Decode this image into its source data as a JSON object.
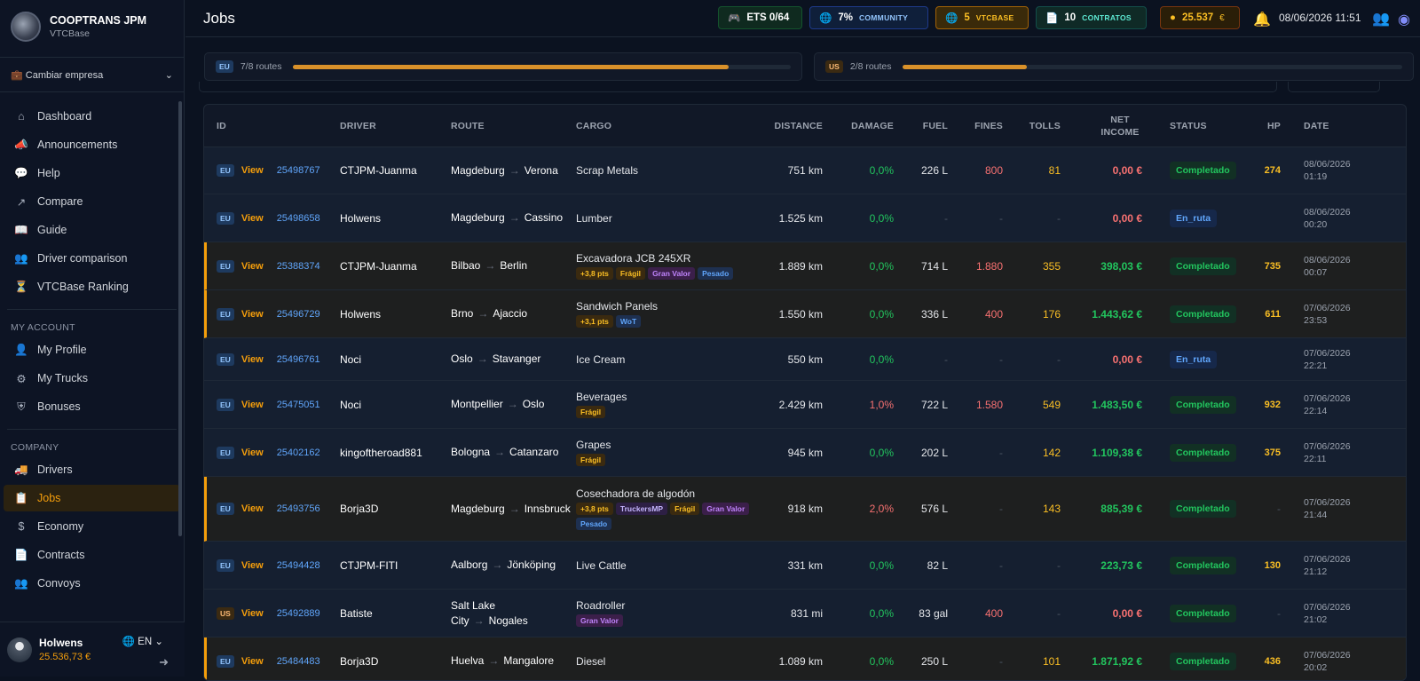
{
  "sidebar": {
    "brand_title": "COOPTRANS JPM",
    "brand_sub": "VTCBase",
    "company_switch": "Cambiar empresa",
    "main_items": [
      {
        "label": "Dashboard",
        "icon": "home-icon"
      },
      {
        "label": "Announcements",
        "icon": "megaphone-icon"
      },
      {
        "label": "Help",
        "icon": "chat-icon"
      },
      {
        "label": "Compare",
        "icon": "chart-line-icon"
      },
      {
        "label": "Guide",
        "icon": "book-icon"
      },
      {
        "label": "Driver comparison",
        "icon": "users-icon"
      },
      {
        "label": "VTCBase Ranking",
        "icon": "trophy-icon"
      }
    ],
    "account_title": "MY ACCOUNT",
    "account_items": [
      {
        "label": "My Profile",
        "icon": "user-icon"
      },
      {
        "label": "My Trucks",
        "icon": "gear-icon"
      },
      {
        "label": "Bonuses",
        "icon": "shield-icon"
      }
    ],
    "company_title": "COMPANY",
    "company_items": [
      {
        "label": "Drivers",
        "icon": "truck-icon"
      },
      {
        "label": "Jobs",
        "icon": "clipboard-icon"
      },
      {
        "label": "Economy",
        "icon": "dollar-icon"
      },
      {
        "label": "Contracts",
        "icon": "document-icon"
      },
      {
        "label": "Convoys",
        "icon": "group-icon"
      }
    ],
    "user_name": "Holwens",
    "user_balance": "25.536,73 €",
    "lang": "EN"
  },
  "topbar": {
    "title": "Jobs",
    "ets": "ETS 0/64",
    "community_value": "7%",
    "community_label": "COMMUNITY",
    "vtcbase_value": "5",
    "vtcbase_label": "VTCBASE",
    "contracts_value": "10",
    "contracts_label": "CONTRATOS",
    "balance": "25.537",
    "balance_currency": "€",
    "datetime": "08/06/2026 11:51"
  },
  "routes": [
    {
      "region": "EU",
      "text": "7/8 routes",
      "fill": 0.875
    },
    {
      "region": "US",
      "text": "2/8 routes",
      "fill": 0.25
    }
  ],
  "table": {
    "headers": [
      "ID",
      "DRIVER",
      "ROUTE",
      "CARGO",
      "DISTANCE",
      "DAMAGE",
      "FUEL",
      "FINES",
      "TOLLS",
      "NET INCOME",
      "STATUS",
      "HP",
      "DATE"
    ],
    "view_label": "View",
    "rows": [
      {
        "region": "EU",
        "id": "25498767",
        "driver": "CTJPM-Juanma",
        "from": "Magdeburg",
        "to": "Verona",
        "cargo": "Scrap Metals",
        "tags": [],
        "distance": "751 km",
        "damage": "0,0%",
        "fuel": "226 L",
        "fines": "800",
        "tolls": "81",
        "income": "0,00 €",
        "status": "Completado",
        "hp": "274",
        "date1": "08/06/2026",
        "date2": "01:19",
        "hl": false
      },
      {
        "region": "EU",
        "id": "25498658",
        "driver": "Holwens",
        "from": "Magdeburg",
        "to": "Cassino",
        "cargo": "Lumber",
        "tags": [],
        "distance": "1.525 km",
        "damage": "0,0%",
        "fuel": "-",
        "fines": "-",
        "tolls": "-",
        "income": "0,00 €",
        "status": "En_ruta",
        "hp": "",
        "date1": "08/06/2026",
        "date2": "00:20",
        "hl": false
      },
      {
        "region": "EU",
        "id": "25388374",
        "driver": "CTJPM-Juanma",
        "from": "Bilbao",
        "to": "Berlin",
        "cargo": "Excavadora JCB 245XR",
        "tags": [
          {
            "t": "+3,8 pts",
            "c": "pts"
          },
          {
            "t": "Frágil",
            "c": "fragil"
          },
          {
            "t": "Gran Valor",
            "c": "gv"
          },
          {
            "t": "Pesado",
            "c": "pes"
          }
        ],
        "distance": "1.889 km",
        "damage": "0,0%",
        "fuel": "714 L",
        "fines": "1.880",
        "tolls": "355",
        "income": "398,03 €",
        "status": "Completado",
        "hp": "735",
        "date1": "08/06/2026",
        "date2": "00:07",
        "hl": true
      },
      {
        "region": "EU",
        "id": "25496729",
        "driver": "Holwens",
        "from": "Brno",
        "to": "Ajaccio",
        "cargo": "Sandwich Panels",
        "tags": [
          {
            "t": "+3,1 pts",
            "c": "pts"
          },
          {
            "t": "WoT",
            "c": "wot"
          }
        ],
        "distance": "1.550 km",
        "damage": "0,0%",
        "fuel": "336 L",
        "fines": "400",
        "tolls": "176",
        "income": "1.443,62 €",
        "status": "Completado",
        "hp": "611",
        "date1": "07/06/2026",
        "date2": "23:53",
        "hl": true
      },
      {
        "region": "EU",
        "id": "25496761",
        "driver": "Noci",
        "from": "Oslo",
        "to": "Stavanger",
        "cargo": "Ice Cream",
        "tags": [],
        "distance": "550 km",
        "damage": "0,0%",
        "fuel": "-",
        "fines": "-",
        "tolls": "-",
        "income": "0,00 €",
        "status": "En_ruta",
        "hp": "",
        "date1": "07/06/2026",
        "date2": "22:21",
        "hl": false
      },
      {
        "region": "EU",
        "id": "25475051",
        "driver": "Noci",
        "from": "Montpellier",
        "to": "Oslo",
        "cargo": "Beverages",
        "tags": [
          {
            "t": "Frágil",
            "c": "fragil"
          }
        ],
        "distance": "2.429 km",
        "damage": "1,0%",
        "fuel": "722 L",
        "fines": "1.580",
        "tolls": "549",
        "income": "1.483,50 €",
        "status": "Completado",
        "hp": "932",
        "date1": "07/06/2026",
        "date2": "22:14",
        "hl": false
      },
      {
        "region": "EU",
        "id": "25402162",
        "driver": "kingoftheroad881",
        "from": "Bologna",
        "to": "Catanzaro",
        "cargo": "Grapes",
        "tags": [
          {
            "t": "Frágil",
            "c": "fragil"
          }
        ],
        "distance": "945 km",
        "damage": "0,0%",
        "fuel": "202 L",
        "fines": "-",
        "tolls": "142",
        "income": "1.109,38 €",
        "status": "Completado",
        "hp": "375",
        "date1": "07/06/2026",
        "date2": "22:11",
        "hl": false
      },
      {
        "region": "EU",
        "id": "25493756",
        "driver": "Borja3D",
        "from": "Magdeburg",
        "to": "Innsbruck",
        "cargo": "Cosechadora de algodón",
        "tags": [
          {
            "t": "+3,8 pts",
            "c": "pts"
          },
          {
            "t": "TruckersMP",
            "c": "tmp"
          },
          {
            "t": "Frágil",
            "c": "fragil"
          },
          {
            "t": "Gran Valor",
            "c": "gv"
          },
          {
            "t": "Pesado",
            "c": "pes"
          }
        ],
        "distance": "918 km",
        "damage": "2,0%",
        "fuel": "576 L",
        "fines": "-",
        "tolls": "143",
        "income": "885,39 €",
        "status": "Completado",
        "hp": "-",
        "date1": "07/06/2026",
        "date2": "21:44",
        "hl": true
      },
      {
        "region": "EU",
        "id": "25494428",
        "driver": "CTJPM-FITI",
        "from": "Aalborg",
        "to": "Jönköping",
        "cargo": "Live Cattle",
        "tags": [],
        "distance": "331 km",
        "damage": "0,0%",
        "fuel": "82 L",
        "fines": "-",
        "tolls": "-",
        "income": "223,73 €",
        "status": "Completado",
        "hp": "130",
        "date1": "07/06/2026",
        "date2": "21:12",
        "hl": false
      },
      {
        "region": "US",
        "id": "25492889",
        "driver": "Batiste",
        "from": "Salt Lake City",
        "to": "Nogales",
        "cargo": "Roadroller",
        "tags": [
          {
            "t": "Gran Valor",
            "c": "gv"
          }
        ],
        "distance": "831 mi",
        "damage": "0,0%",
        "fuel": "83 gal",
        "fines": "400",
        "tolls": "-",
        "income": "0,00 €",
        "status": "Completado",
        "hp": "-",
        "date1": "07/06/2026",
        "date2": "21:02",
        "hl": false
      },
      {
        "region": "EU",
        "id": "25484483",
        "driver": "Borja3D",
        "from": "Huelva",
        "to": "Mangalore",
        "cargo": "Diesel",
        "tags": [],
        "distance": "1.089 km",
        "damage": "0,0%",
        "fuel": "250 L",
        "fines": "-",
        "tolls": "101",
        "income": "1.871,92 €",
        "status": "Completado",
        "hp": "436",
        "date1": "07/06/2026",
        "date2": "20:02",
        "hl": true
      }
    ]
  }
}
